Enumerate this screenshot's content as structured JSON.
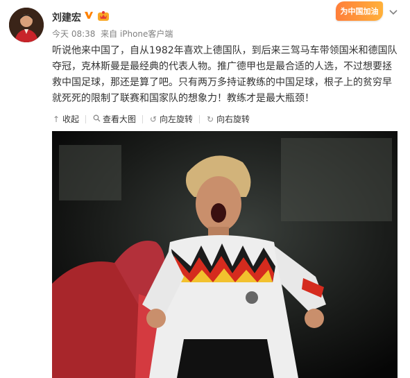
{
  "post": {
    "username": "刘建宏",
    "topic_badge": "为中国加油",
    "time": "今天 08:38",
    "source_prefix": "来自",
    "source": "iPhone客户端",
    "text": "听说他来中国了，自从1982年喜欢上德国队，到后来三驾马车带领国米和德国队夺冠，克林斯曼是最经典的代表人物。推广德甲也是最合适的人选，不过想要拯救中国足球，那还是算了吧。只有两万多持证教练的中国足球，根子上的贫穷早就死死的限制了联赛和国家队的想象力！教练才是最大瓶颈！"
  },
  "actions": {
    "collapse": "收起",
    "view_large": "查看大图",
    "rotate_left": "向左旋转",
    "rotate_right": "向右旋转"
  },
  "icons": {
    "vip": "verified-v-icon",
    "member": "member-crown-icon",
    "more": "chevron-down-icon",
    "collapse": "arrow-up-icon",
    "view_large": "magnifier-icon",
    "rotate_left": "rotate-left-icon",
    "rotate_right": "rotate-right-icon"
  },
  "colors": {
    "text": "#333333",
    "meta": "#808080",
    "vip_orange": "#ff8200",
    "badge_gradient_start": "#ff7e3a",
    "badge_gradient_end": "#ffb13a"
  }
}
